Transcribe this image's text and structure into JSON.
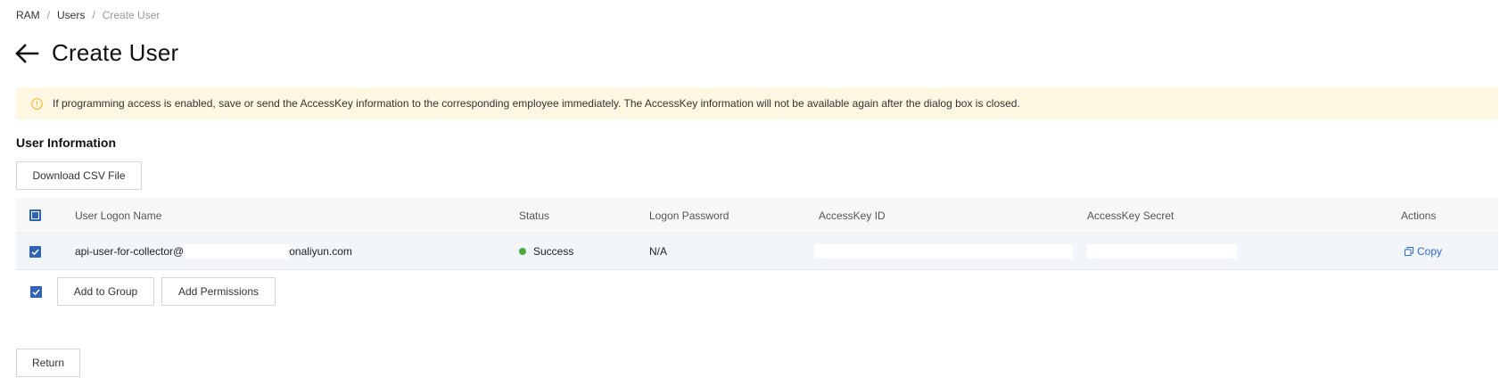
{
  "breadcrumb": {
    "items": [
      "RAM",
      "Users",
      "Create User"
    ],
    "separator": "/"
  },
  "page": {
    "title": "Create User",
    "back_icon": "arrow-left-icon"
  },
  "alert": {
    "icon": "info-circle-icon",
    "text": "If programming access is enabled, save or send the AccessKey information to the corresponding employee immediately. The AccessKey information will not be available again after the dialog box is closed.",
    "color": "#fff7e1"
  },
  "section": {
    "title": "User Information"
  },
  "toolbar": {
    "download_csv": "Download CSV File"
  },
  "table": {
    "columns": [
      "User Logon Name",
      "Status",
      "Logon Password",
      "AccessKey ID",
      "AccessKey Secret",
      "Actions"
    ],
    "rows": [
      {
        "checked": true,
        "logon_name_prefix": "api-user-for-collector@",
        "logon_name_suffix": "onaliyun.com",
        "status": "Success",
        "status_color": "#4caa3a",
        "logon_password": "N/A",
        "access_key_id": "",
        "access_key_secret": "",
        "action": "Copy"
      }
    ]
  },
  "bulk_actions": {
    "add_to_group": "Add to Group",
    "add_permissions": "Add Permissions"
  },
  "footer": {
    "return_label": "Return"
  },
  "colors": {
    "accent": "#2f63b8",
    "link": "#2d6ad6",
    "success": "#4caa3a"
  }
}
